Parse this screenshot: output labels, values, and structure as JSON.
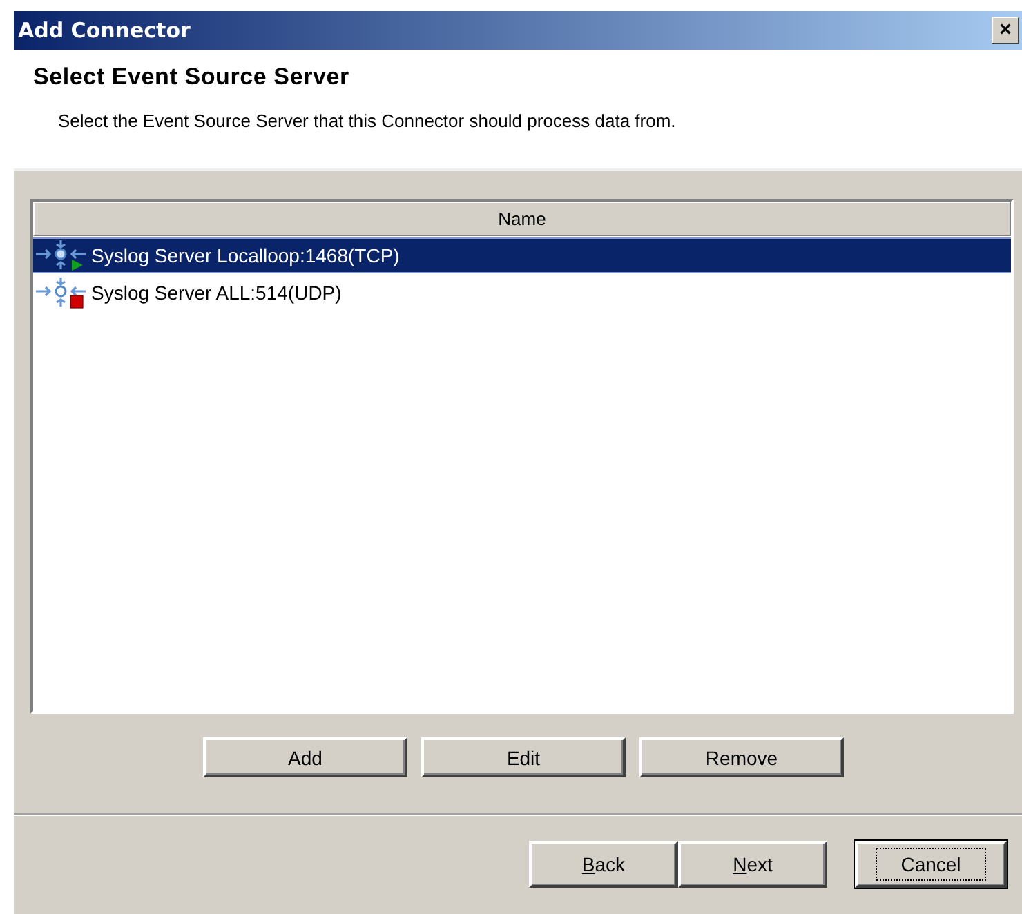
{
  "window": {
    "title": "Add Connector",
    "close": "×"
  },
  "header": {
    "title": "Select Event Source Server",
    "description": "Select the Event Source Server that this Connector should process data from."
  },
  "list": {
    "columns": [
      "Name"
    ],
    "rows": [
      {
        "name": "Syslog Server Localloop:1468(TCP)",
        "kind": "running",
        "selected": true
      },
      {
        "name": "Syslog Server ALL:514(UDP)",
        "kind": "stopped",
        "selected": false
      }
    ]
  },
  "list_buttons": [
    "Add",
    "Edit",
    "Remove"
  ],
  "nav_buttons": [
    {
      "label": "Back",
      "underline_first": true,
      "default": false
    },
    {
      "label": "Next",
      "underline_first": true,
      "default": false
    },
    {
      "label": "Cancel",
      "underline_first": false,
      "default": true
    }
  ]
}
